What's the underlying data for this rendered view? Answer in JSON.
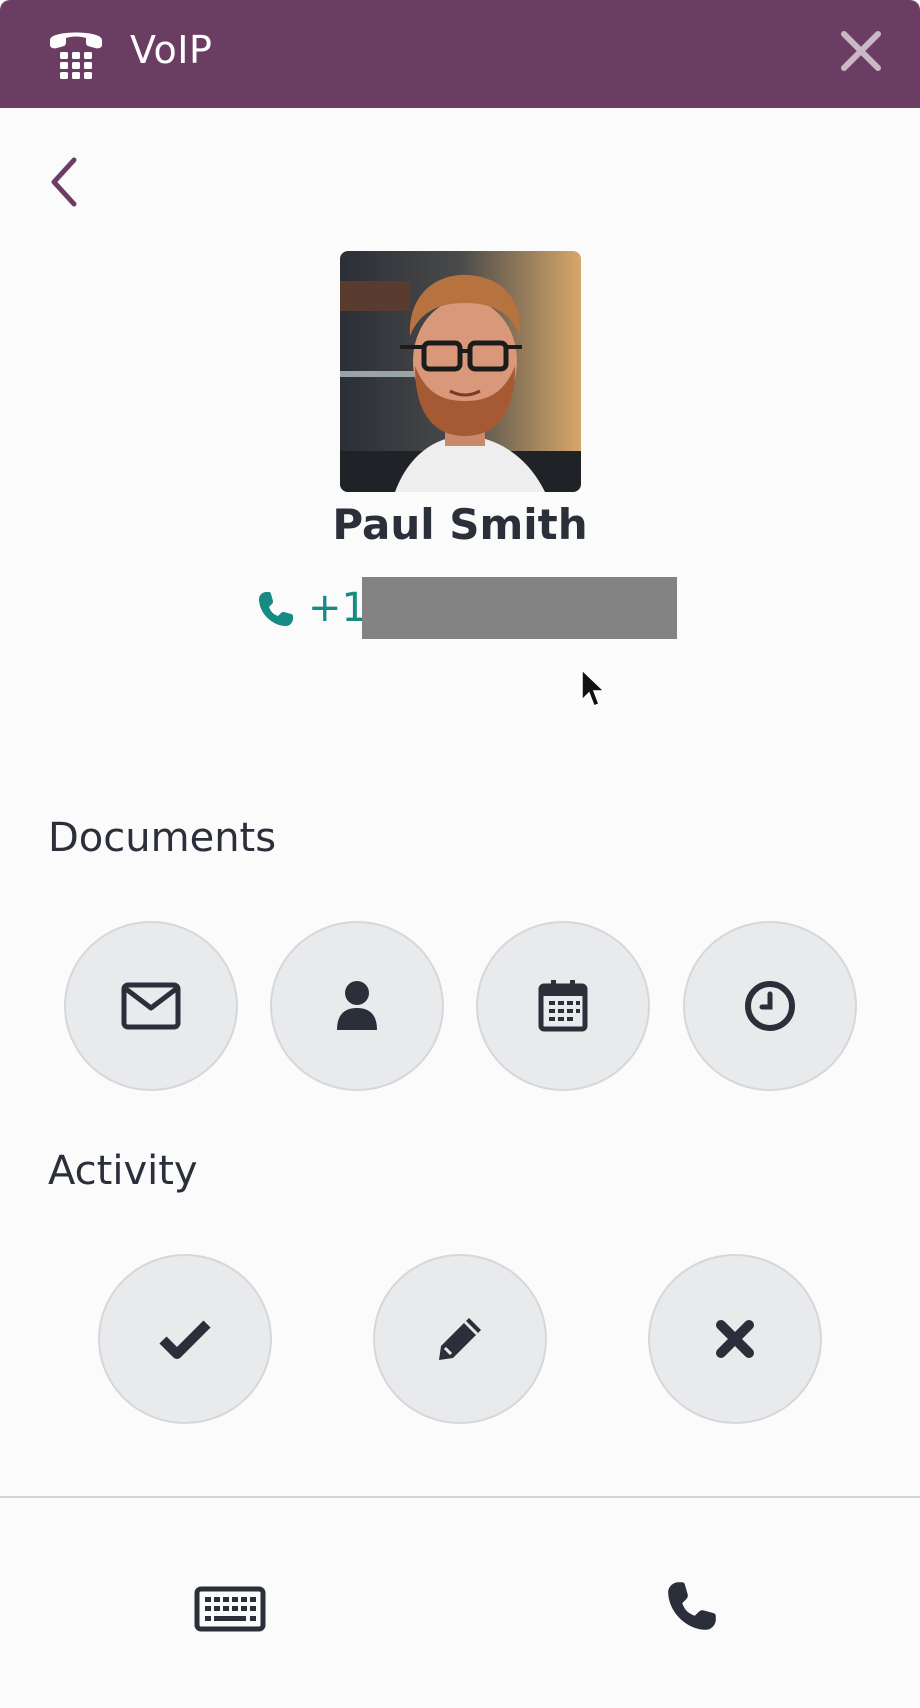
{
  "header": {
    "title": "VoIP",
    "logo_icon": "telephone-keypad-icon",
    "close_icon": "close-icon",
    "background_color": "#6b3d63"
  },
  "navigation": {
    "back_icon": "chevron-left-icon"
  },
  "contact": {
    "name": "Paul Smith",
    "phone_prefix": "+1",
    "phone_icon": "phone-icon",
    "phone_color": "#178a84"
  },
  "documents": {
    "title": "Documents",
    "buttons": [
      {
        "icon": "envelope-icon"
      },
      {
        "icon": "user-icon"
      },
      {
        "icon": "calendar-icon"
      },
      {
        "icon": "clock-icon"
      }
    ]
  },
  "activity": {
    "title": "Activity",
    "buttons": [
      {
        "icon": "check-icon"
      },
      {
        "icon": "pencil-icon"
      },
      {
        "icon": "times-icon"
      }
    ]
  },
  "footer": {
    "keypad_icon": "keyboard-icon",
    "call_icon": "phone-icon"
  }
}
